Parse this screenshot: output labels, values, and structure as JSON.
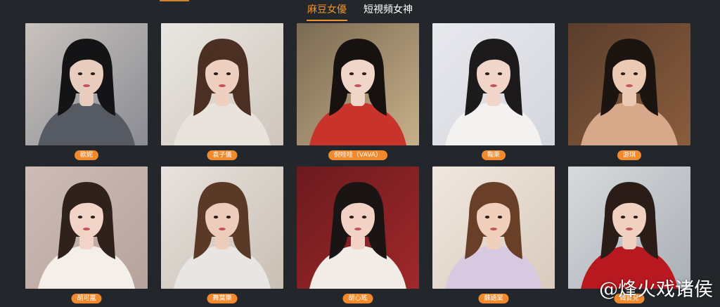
{
  "tabs": [
    {
      "label": "麻豆女優",
      "active": true
    },
    {
      "label": "短視頻女神",
      "active": false
    }
  ],
  "actresses": [
    {
      "name": "歐妮",
      "palette": {
        "bg": "#c9c2bd",
        "bg2": "#8a8c93",
        "hair": "#141416",
        "skin": "#e8cdbf",
        "cloth": "#555a63"
      }
    },
    {
      "name": "袁子儀",
      "palette": {
        "bg": "#e9e6e1",
        "bg2": "#cfc6bd",
        "hair": "#4a2f22",
        "skin": "#efcfbf",
        "cloth": "#e9e3dd"
      }
    },
    {
      "name": "倪哇哇（VAVA）",
      "palette": {
        "bg": "#7a6a52",
        "bg2": "#c8b08a",
        "hair": "#17120f",
        "skin": "#f0d6c9",
        "cloth": "#c8332c"
      }
    },
    {
      "name": "鞠萊",
      "palette": {
        "bg": "#e8e9ee",
        "bg2": "#d4d6dd",
        "hair": "#1c1a1b",
        "skin": "#f1d5c8",
        "cloth": "#f4f2f0"
      }
    },
    {
      "name": "游琪",
      "palette": {
        "bg": "#5a3d2c",
        "bg2": "#8a5d3c",
        "hair": "#1c1411",
        "skin": "#ecc9b3",
        "cloth": "#d7a98a"
      }
    },
    {
      "name": "胡可嵐",
      "palette": {
        "bg": "#cdbcb6",
        "bg2": "#b7a39c",
        "hair": "#2f211b",
        "skin": "#f1d4c7",
        "cloth": "#f5efe9"
      }
    },
    {
      "name": "舞葉樂",
      "palette": {
        "bg": "#e7e2dd",
        "bg2": "#c9bfb4",
        "hair": "#5a3926",
        "skin": "#eccdbc",
        "cloth": "#e8e5e2"
      }
    },
    {
      "name": "胡心瑤",
      "palette": {
        "bg": "#6b1a1e",
        "bg2": "#a0282a",
        "hair": "#1a1414",
        "skin": "#f1d2c4",
        "cloth": "#f2ece6"
      }
    },
    {
      "name": "蘇語棠",
      "palette": {
        "bg": "#efe7df",
        "bg2": "#d9cbbd",
        "hair": "#6a3f28",
        "skin": "#f0cfbd",
        "cloth": "#d7c9e0"
      }
    },
    {
      "name": "韓寶兒",
      "palette": {
        "bg": "#d8dadc",
        "bg2": "#a9afb6",
        "hair": "#2a1d18",
        "skin": "#efd0c1",
        "cloth": "#b8181f"
      }
    }
  ],
  "watermark": "@烽火戏诸侯"
}
